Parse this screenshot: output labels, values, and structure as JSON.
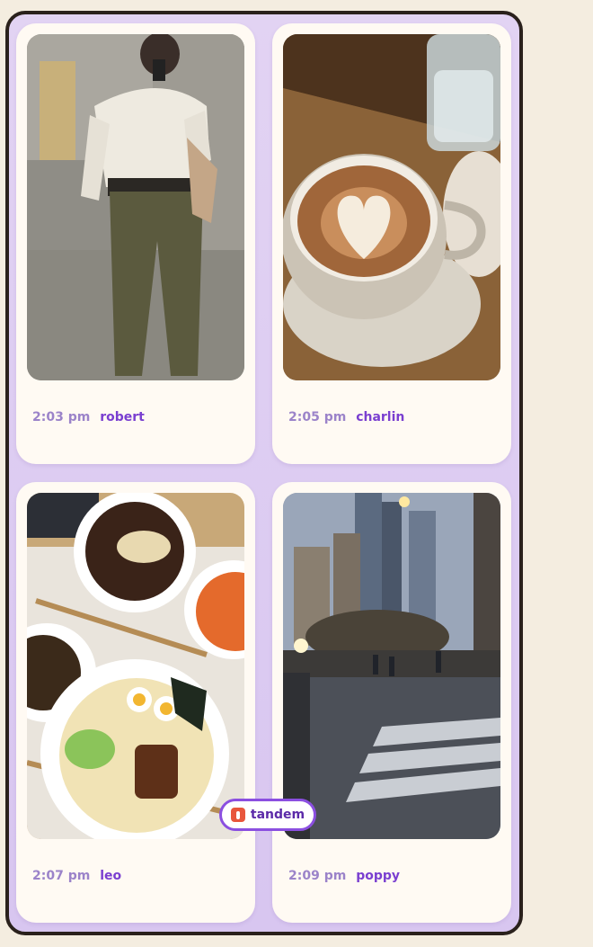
{
  "posts": [
    {
      "time": "2:03 pm",
      "name": "robert",
      "photo_icon": "person-mirror-selfie"
    },
    {
      "time": "2:05 pm",
      "name": "charlin",
      "photo_icon": "latte-cup"
    },
    {
      "time": "2:07 pm",
      "name": "leo",
      "photo_icon": "ramen-bowls"
    },
    {
      "time": "2:09 pm",
      "name": "poppy",
      "photo_icon": "city-street"
    }
  ],
  "badge": {
    "label": "tandem"
  },
  "colors": {
    "background": "#f4ede0",
    "frame": "#d8c6f0",
    "card": "#fffaf3",
    "time_text": "#9b83c9",
    "name_text": "#7a3fd0",
    "badge_border": "#8b4fe0"
  }
}
